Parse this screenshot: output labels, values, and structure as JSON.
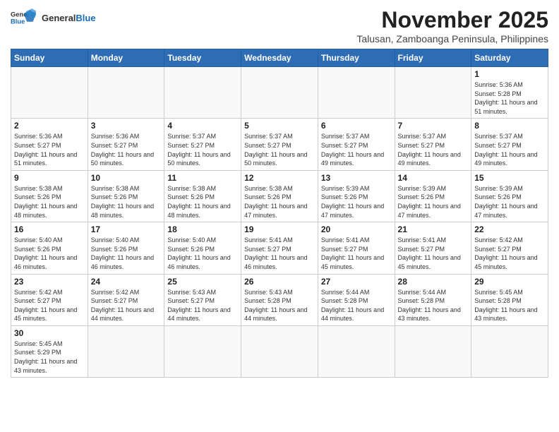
{
  "header": {
    "logo_general": "General",
    "logo_blue": "Blue",
    "title": "November 2025",
    "subtitle": "Talusan, Zamboanga Peninsula, Philippines"
  },
  "weekdays": [
    "Sunday",
    "Monday",
    "Tuesday",
    "Wednesday",
    "Thursday",
    "Friday",
    "Saturday"
  ],
  "days": {
    "1": {
      "sunrise": "5:36 AM",
      "sunset": "5:28 PM",
      "daylight": "11 hours and 51 minutes."
    },
    "2": {
      "sunrise": "5:36 AM",
      "sunset": "5:27 PM",
      "daylight": "11 hours and 51 minutes."
    },
    "3": {
      "sunrise": "5:36 AM",
      "sunset": "5:27 PM",
      "daylight": "11 hours and 50 minutes."
    },
    "4": {
      "sunrise": "5:37 AM",
      "sunset": "5:27 PM",
      "daylight": "11 hours and 50 minutes."
    },
    "5": {
      "sunrise": "5:37 AM",
      "sunset": "5:27 PM",
      "daylight": "11 hours and 50 minutes."
    },
    "6": {
      "sunrise": "5:37 AM",
      "sunset": "5:27 PM",
      "daylight": "11 hours and 49 minutes."
    },
    "7": {
      "sunrise": "5:37 AM",
      "sunset": "5:27 PM",
      "daylight": "11 hours and 49 minutes."
    },
    "8": {
      "sunrise": "5:37 AM",
      "sunset": "5:27 PM",
      "daylight": "11 hours and 49 minutes."
    },
    "9": {
      "sunrise": "5:38 AM",
      "sunset": "5:26 PM",
      "daylight": "11 hours and 48 minutes."
    },
    "10": {
      "sunrise": "5:38 AM",
      "sunset": "5:26 PM",
      "daylight": "11 hours and 48 minutes."
    },
    "11": {
      "sunrise": "5:38 AM",
      "sunset": "5:26 PM",
      "daylight": "11 hours and 48 minutes."
    },
    "12": {
      "sunrise": "5:38 AM",
      "sunset": "5:26 PM",
      "daylight": "11 hours and 47 minutes."
    },
    "13": {
      "sunrise": "5:39 AM",
      "sunset": "5:26 PM",
      "daylight": "11 hours and 47 minutes."
    },
    "14": {
      "sunrise": "5:39 AM",
      "sunset": "5:26 PM",
      "daylight": "11 hours and 47 minutes."
    },
    "15": {
      "sunrise": "5:39 AM",
      "sunset": "5:26 PM",
      "daylight": "11 hours and 47 minutes."
    },
    "16": {
      "sunrise": "5:40 AM",
      "sunset": "5:26 PM",
      "daylight": "11 hours and 46 minutes."
    },
    "17": {
      "sunrise": "5:40 AM",
      "sunset": "5:26 PM",
      "daylight": "11 hours and 46 minutes."
    },
    "18": {
      "sunrise": "5:40 AM",
      "sunset": "5:26 PM",
      "daylight": "11 hours and 46 minutes."
    },
    "19": {
      "sunrise": "5:41 AM",
      "sunset": "5:27 PM",
      "daylight": "11 hours and 46 minutes."
    },
    "20": {
      "sunrise": "5:41 AM",
      "sunset": "5:27 PM",
      "daylight": "11 hours and 45 minutes."
    },
    "21": {
      "sunrise": "5:41 AM",
      "sunset": "5:27 PM",
      "daylight": "11 hours and 45 minutes."
    },
    "22": {
      "sunrise": "5:42 AM",
      "sunset": "5:27 PM",
      "daylight": "11 hours and 45 minutes."
    },
    "23": {
      "sunrise": "5:42 AM",
      "sunset": "5:27 PM",
      "daylight": "11 hours and 45 minutes."
    },
    "24": {
      "sunrise": "5:42 AM",
      "sunset": "5:27 PM",
      "daylight": "11 hours and 44 minutes."
    },
    "25": {
      "sunrise": "5:43 AM",
      "sunset": "5:27 PM",
      "daylight": "11 hours and 44 minutes."
    },
    "26": {
      "sunrise": "5:43 AM",
      "sunset": "5:28 PM",
      "daylight": "11 hours and 44 minutes."
    },
    "27": {
      "sunrise": "5:44 AM",
      "sunset": "5:28 PM",
      "daylight": "11 hours and 44 minutes."
    },
    "28": {
      "sunrise": "5:44 AM",
      "sunset": "5:28 PM",
      "daylight": "11 hours and 43 minutes."
    },
    "29": {
      "sunrise": "5:45 AM",
      "sunset": "5:28 PM",
      "daylight": "11 hours and 43 minutes."
    },
    "30": {
      "sunrise": "5:45 AM",
      "sunset": "5:29 PM",
      "daylight": "11 hours and 43 minutes."
    }
  }
}
